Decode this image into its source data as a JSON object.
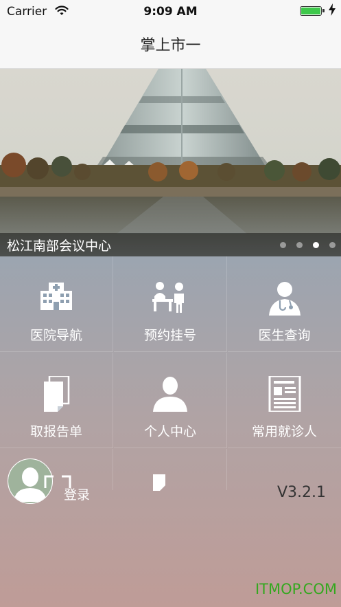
{
  "status_bar": {
    "carrier": "Carrier",
    "time": "9:09 AM"
  },
  "nav": {
    "title": "掌上市一"
  },
  "banner": {
    "caption": "松江南部会议中心",
    "dot_count": 4,
    "active_dot": 2
  },
  "menu": [
    {
      "label": "医院导航",
      "icon": "hospital-building-icon"
    },
    {
      "label": "预约挂号",
      "icon": "registration-desk-icon"
    },
    {
      "label": "医生查询",
      "icon": "doctor-icon"
    },
    {
      "label": "取报告单",
      "icon": "report-document-icon"
    },
    {
      "label": "个人中心",
      "icon": "person-icon"
    },
    {
      "label": "常用就诊人",
      "icon": "patient-list-icon"
    }
  ],
  "login": {
    "label": "登录",
    "icon": "user-avatar-icon"
  },
  "version": "V3.2.1",
  "watermark": "ITMOP.COM",
  "colors": {
    "battery": "#3ec84b",
    "watermark": "#34a81f"
  }
}
